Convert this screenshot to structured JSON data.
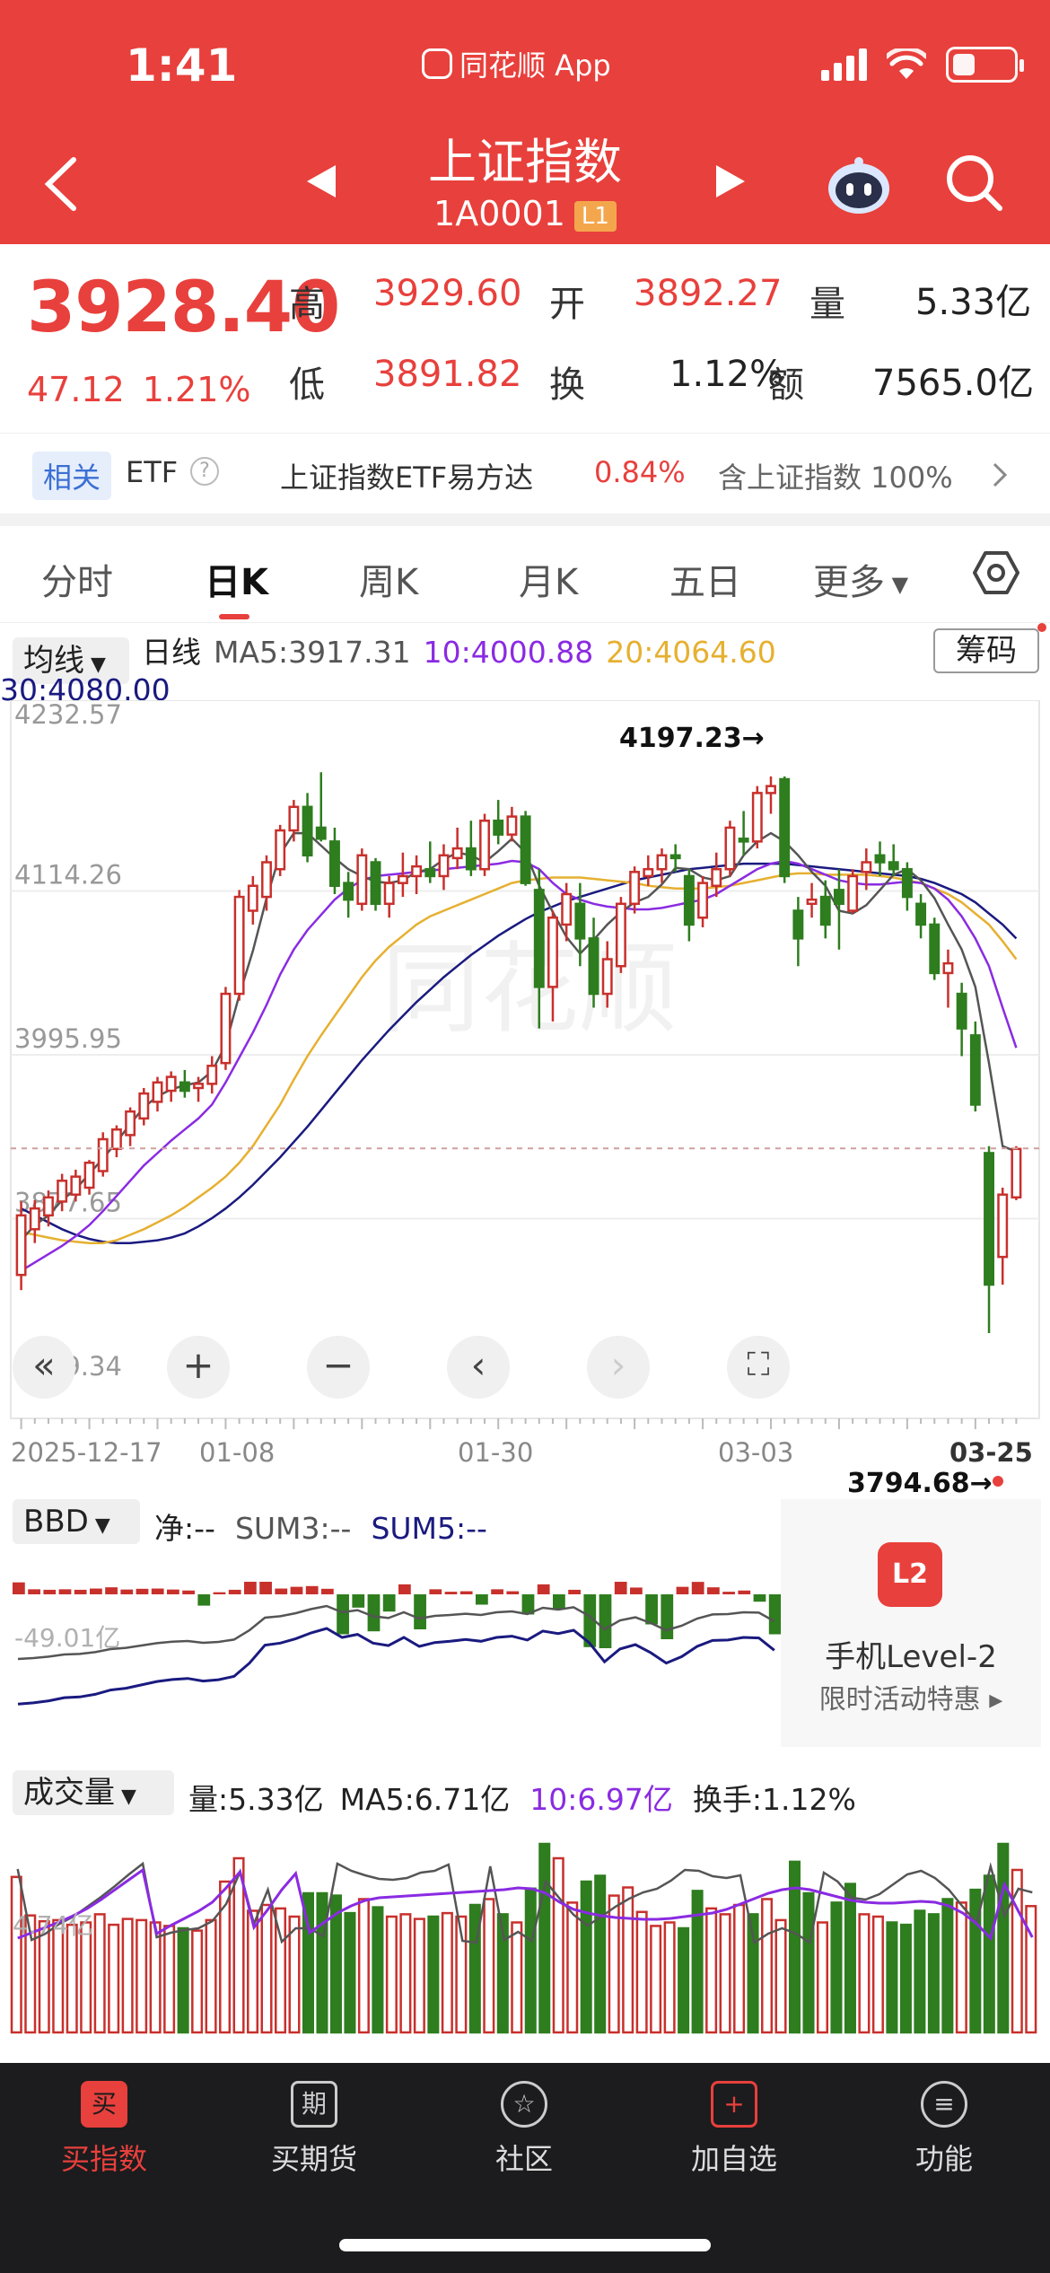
{
  "status": {
    "time": "1:41",
    "app": "同花顺 App"
  },
  "header": {
    "title": "上证指数",
    "code": "1A0001",
    "badge": "L1"
  },
  "quote": {
    "price": "3928.40",
    "change": "47.12",
    "change_pct": "1.21%",
    "high_label": "高",
    "high": "3929.60",
    "open_label": "开",
    "open": "3892.27",
    "vol_label": "量",
    "vol": "5.33亿",
    "low_label": "低",
    "low": "3891.82",
    "turnover_label": "换",
    "turnover": "1.12%",
    "amount_label": "额",
    "amount": "7565.0亿"
  },
  "related": {
    "tag": "相关",
    "etf": "ETF",
    "help": "?",
    "name": "上证指数ETF易方达",
    "pct": "0.84%",
    "holding": "含上证指数 100%"
  },
  "tabs": [
    "分时",
    "日K",
    "周K",
    "月K",
    "五日",
    "更多"
  ],
  "ma": {
    "button": "均线",
    "label": "日线",
    "ma5": "MA5:3917.31",
    "ma10": "10:4000.88",
    "ma20": "20:4064.60",
    "ma30": "30:4080.00",
    "chip_button": "筹码",
    "colors": {
      "ma5": "#555555",
      "ma10": "#8a2be2",
      "ma20": "#e6b030",
      "ma30": "#1a1a80"
    }
  },
  "chart_data": {
    "type": "candlestick",
    "y_ticks": [
      "4232.57",
      "4114.26",
      "3995.95",
      "3877.65",
      "3759.34"
    ],
    "x_ticks": [
      "2025-12-17",
      "01-08",
      "01-30",
      "03-03",
      "03-25"
    ],
    "max_marker": "4197.23→",
    "min_marker": "3794.68→",
    "watermark": "同花顺",
    "ylim": [
      3759.34,
      4232.57
    ],
    "last_close": 3928.4,
    "candles_ohlc": [
      [
        3837,
        3890,
        3826,
        3880
      ],
      [
        3870,
        3891,
        3860,
        3885
      ],
      [
        3880,
        3898,
        3872,
        3893
      ],
      [
        3890,
        3910,
        3883,
        3905
      ],
      [
        3895,
        3913,
        3890,
        3908
      ],
      [
        3900,
        3920,
        3895,
        3918
      ],
      [
        3912,
        3940,
        3908,
        3935
      ],
      [
        3928,
        3945,
        3922,
        3942
      ],
      [
        3938,
        3958,
        3930,
        3955
      ],
      [
        3950,
        3972,
        3945,
        3968
      ],
      [
        3962,
        3980,
        3955,
        3976
      ],
      [
        3970,
        3984,
        3962,
        3980
      ],
      [
        3976,
        3985,
        3965,
        3970
      ],
      [
        3972,
        3980,
        3962,
        3975
      ],
      [
        3975,
        3995,
        3968,
        3988
      ],
      [
        3990,
        4045,
        3985,
        4040
      ],
      [
        4040,
        4115,
        4035,
        4110
      ],
      [
        4100,
        4125,
        4090,
        4118
      ],
      [
        4110,
        4140,
        4100,
        4135
      ],
      [
        4130,
        4162,
        4125,
        4158
      ],
      [
        4158,
        4180,
        4150,
        4175
      ],
      [
        4175,
        4185,
        4135,
        4140
      ],
      [
        4160,
        4200,
        4150,
        4152
      ],
      [
        4150,
        4160,
        4112,
        4118
      ],
      [
        4120,
        4128,
        4095,
        4108
      ],
      [
        4105,
        4145,
        4100,
        4140
      ],
      [
        4135,
        4138,
        4100,
        4105
      ],
      [
        4105,
        4125,
        4095,
        4120
      ],
      [
        4120,
        4142,
        4110,
        4125
      ],
      [
        4125,
        4140,
        4112,
        4132
      ],
      [
        4130,
        4150,
        4120,
        4125
      ],
      [
        4125,
        4148,
        4115,
        4140
      ],
      [
        4138,
        4160,
        4130,
        4145
      ],
      [
        4145,
        4165,
        4125,
        4130
      ],
      [
        4130,
        4170,
        4125,
        4165
      ],
      [
        4165,
        4180,
        4148,
        4155
      ],
      [
        4155,
        4175,
        4150,
        4168
      ],
      [
        4168,
        4172,
        4118,
        4120
      ],
      [
        4115,
        4130,
        4015,
        4045
      ],
      [
        4045,
        4100,
        4020,
        4095
      ],
      [
        4090,
        4120,
        4078,
        4112
      ],
      [
        4105,
        4120,
        4060,
        4080
      ],
      [
        4080,
        4095,
        4030,
        4040
      ],
      [
        4040,
        4078,
        4030,
        4065
      ],
      [
        4060,
        4110,
        4055,
        4105
      ],
      [
        4105,
        4132,
        4098,
        4128
      ],
      [
        4125,
        4140,
        4118,
        4130
      ],
      [
        4130,
        4145,
        4120,
        4140
      ],
      [
        4140,
        4148,
        4128,
        4138
      ],
      [
        4125,
        4130,
        4078,
        4090
      ],
      [
        4095,
        4125,
        4088,
        4120
      ],
      [
        4118,
        4142,
        4110,
        4130
      ],
      [
        4130,
        4165,
        4125,
        4160
      ],
      [
        4152,
        4172,
        4140,
        4150
      ],
      [
        4150,
        4190,
        4145,
        4185
      ],
      [
        4185,
        4197,
        4170,
        4190
      ],
      [
        4195,
        4197,
        4120,
        4125
      ],
      [
        4100,
        4110,
        4060,
        4080
      ],
      [
        4105,
        4120,
        4095,
        4108
      ],
      [
        4110,
        4122,
        4080,
        4090
      ],
      [
        4115,
        4130,
        4072,
        4105
      ],
      [
        4100,
        4130,
        4098,
        4125
      ],
      [
        4128,
        4145,
        4115,
        4135
      ],
      [
        4140,
        4150,
        4125,
        4135
      ],
      [
        4135,
        4148,
        4125,
        4130
      ],
      [
        4130,
        4135,
        4100,
        4110
      ],
      [
        4105,
        4112,
        4080,
        4090
      ],
      [
        4090,
        4095,
        4050,
        4055
      ],
      [
        4055,
        4072,
        4030,
        4062
      ],
      [
        4040,
        4048,
        3995,
        4015
      ],
      [
        4010,
        4020,
        3955,
        3960
      ],
      [
        3925,
        3930,
        3795,
        3830
      ],
      [
        3850,
        3900,
        3830,
        3895
      ],
      [
        3893,
        3930,
        3891,
        3928
      ]
    ],
    "ma5": [
      3862,
      3873,
      3880,
      3891,
      3899,
      3910,
      3921,
      3933,
      3946,
      3958,
      3966,
      3971,
      3974,
      3976,
      3984,
      4003,
      4039,
      4071,
      4109,
      4141,
      4156,
      4156,
      4147,
      4138,
      4130,
      4125,
      4121,
      4120,
      4122,
      4128,
      4130,
      4137,
      4142,
      4140,
      4135,
      4143,
      4152,
      4142,
      4118,
      4099,
      4081,
      4069,
      4079,
      4090,
      4099,
      4106,
      4110,
      4119,
      4131,
      4130,
      4124,
      4122,
      4125,
      4140,
      4150,
      4156,
      4150,
      4140,
      4128,
      4118,
      4100,
      4098,
      4104,
      4115,
      4126,
      4130,
      4122,
      4109,
      4090,
      4072,
      4045,
      3990,
      3930,
      3926
    ],
    "ma10": [
      3840,
      3846,
      3852,
      3858,
      3865,
      3873,
      3883,
      3894,
      3905,
      3916,
      3925,
      3934,
      3942,
      3950,
      3960,
      3976,
      3994,
      4012,
      4032,
      4054,
      4072,
      4086,
      4097,
      4108,
      4116,
      4122,
      4125,
      4126,
      4127,
      4128,
      4129,
      4130,
      4131,
      4132,
      4133,
      4134,
      4136,
      4135,
      4130,
      4120,
      4112,
      4108,
      4105,
      4103,
      4102,
      4101,
      4101,
      4102,
      4104,
      4106,
      4108,
      4112,
      4118,
      4124,
      4130,
      4134,
      4136,
      4134,
      4130,
      4126,
      4122,
      4120,
      4119,
      4119,
      4120,
      4121,
      4120,
      4116,
      4108,
      4096,
      4080,
      4060,
      4030,
      4001
    ],
    "ma20": [
      3868,
      3866,
      3864,
      3862,
      3861,
      3860,
      3860,
      3862,
      3866,
      3870,
      3875,
      3880,
      3886,
      3893,
      3900,
      3908,
      3918,
      3930,
      3945,
      3960,
      3978,
      3995,
      4010,
      4024,
      4038,
      4052,
      4064,
      4074,
      4082,
      4090,
      4096,
      4100,
      4104,
      4108,
      4112,
      4116,
      4120,
      4122,
      4123,
      4124,
      4124,
      4124,
      4123,
      4122,
      4121,
      4120,
      4118,
      4117,
      4116,
      4116,
      4116,
      4117,
      4118,
      4120,
      4122,
      4124,
      4126,
      4127,
      4127,
      4126,
      4126,
      4126,
      4126,
      4125,
      4124,
      4122,
      4120,
      4116,
      4112,
      4106,
      4098,
      4090,
      4078,
      4065
    ],
    "ma30": [
      3885,
      3880,
      3875,
      3870,
      3866,
      3863,
      3861,
      3860,
      3860,
      3861,
      3862,
      3864,
      3867,
      3872,
      3878,
      3885,
      3893,
      3902,
      3912,
      3922,
      3933,
      3944,
      3956,
      3968,
      3980,
      3992,
      4003,
      4014,
      4024,
      4034,
      4043,
      4052,
      4060,
      4068,
      4075,
      4082,
      4088,
      4094,
      4099,
      4103,
      4107,
      4110,
      4113,
      4116,
      4119,
      4122,
      4124,
      4126,
      4128,
      4130,
      4131,
      4132,
      4133,
      4134,
      4134,
      4134,
      4134,
      4133,
      4132,
      4131,
      4130,
      4129,
      4128,
      4127,
      4126,
      4125,
      4123,
      4120,
      4116,
      4112,
      4106,
      4098,
      4090,
      4080
    ]
  },
  "bbd": {
    "button": "BBD",
    "net": "净:--",
    "sum3": "SUM3:--",
    "sum5": "SUM5:--",
    "axis": "-49.01亿"
  },
  "promo": {
    "icon": "L2",
    "title": "手机Level-2",
    "subtitle": "限时活动特惠"
  },
  "volume": {
    "button": "成交量",
    "vol": "量:5.33亿",
    "ma5": "MA5:6.71亿",
    "ma10": "10:6.97亿",
    "turnover": "换手:1.12%",
    "axis": "4.74亿"
  },
  "bottom_nav": [
    {
      "icon": "买",
      "label": "买指数"
    },
    {
      "icon": "期",
      "label": "买期货"
    },
    {
      "icon": "☆",
      "label": "社区"
    },
    {
      "icon": "+",
      "label": "加自选"
    },
    {
      "icon": "≡",
      "label": "功能"
    }
  ]
}
